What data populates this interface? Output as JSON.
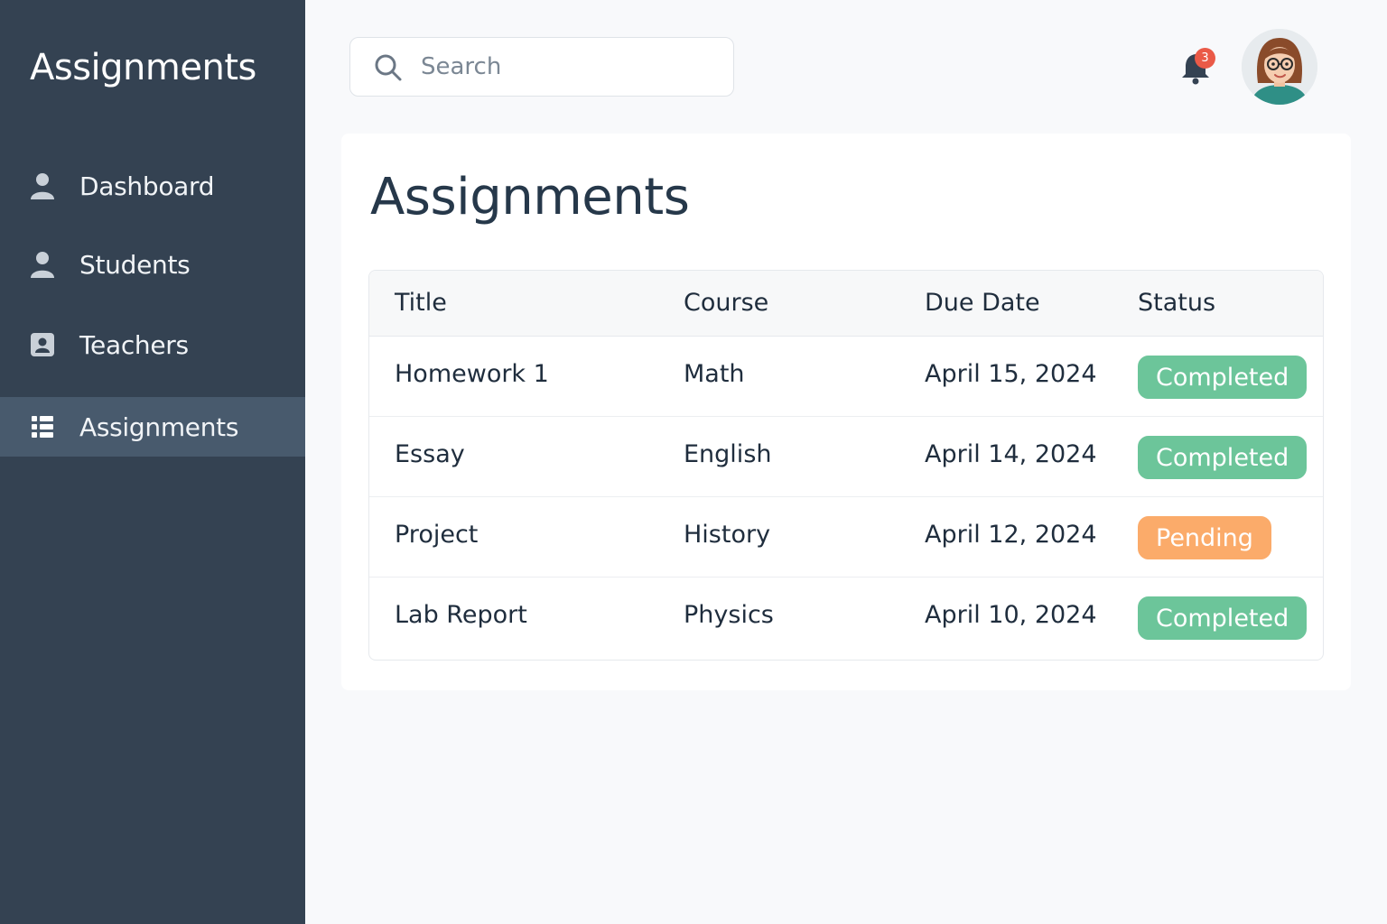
{
  "sidebar": {
    "title": "Assignments",
    "items": [
      {
        "label": "Dashboard",
        "icon": "user-icon"
      },
      {
        "label": "Students",
        "icon": "user-icon"
      },
      {
        "label": "Teachers",
        "icon": "id-card-icon"
      },
      {
        "label": "Assignments",
        "icon": "list-icon",
        "active": true
      }
    ]
  },
  "header": {
    "search": {
      "placeholder": "Search",
      "value": ""
    },
    "notifications": {
      "count": "3"
    }
  },
  "main": {
    "title": "Assignments",
    "table": {
      "columns": [
        "Title",
        "Course",
        "Due Date",
        "Status"
      ],
      "rows": [
        {
          "title": "Homework 1",
          "course": "Math",
          "due": "April 15, 2024",
          "status": "Completed"
        },
        {
          "title": "Essay",
          "course": "English",
          "due": "April 14, 2024",
          "status": "Completed"
        },
        {
          "title": "Project",
          "course": "History",
          "due": "April 12, 2024",
          "status": "Pending"
        },
        {
          "title": "Lab Report",
          "course": "Physics",
          "due": "April 10, 2024",
          "status": "Completed"
        }
      ]
    }
  },
  "colors": {
    "sidebar": "#344252",
    "sidebar_active": "#485a6d",
    "completed": "#6cc59a",
    "pending": "#fbab6a",
    "notification": "#ea5a47"
  }
}
